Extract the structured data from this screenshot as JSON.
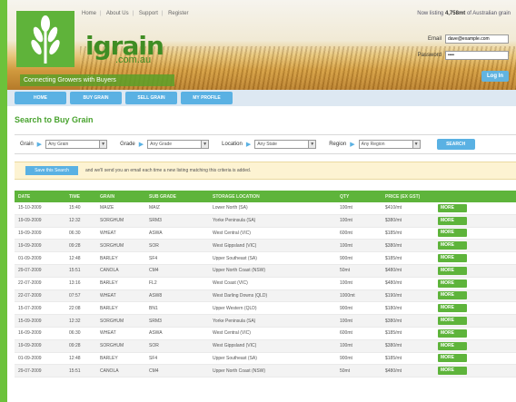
{
  "app": {
    "logo_text": "igrain",
    "logo_domain": ".com.au",
    "tagline": "Connecting Growers with Buyers"
  },
  "header": {
    "links": [
      "Home",
      "About Us",
      "Support",
      "Register"
    ],
    "listing_msg_count": "4,758mt",
    "listing_msg_prefix": "Now listing",
    "listing_msg_suffix": "of Australian grain"
  },
  "login": {
    "email_label": "Email",
    "email_value": "dave@example.com",
    "password_label": "Password",
    "password_value": "••••",
    "button": "Log In"
  },
  "nav": {
    "items": [
      "HOME",
      "BUY GRAIN",
      "SELL GRAIN",
      "MY PROFILE"
    ]
  },
  "search": {
    "title": "Search to Buy Grain",
    "grain_label": "Grain",
    "grain_value": "Any Grain",
    "grade_label": "Grade",
    "grade_value": "Any Grade",
    "location_label": "Location",
    "location_value": "Any State",
    "region_label": "Region",
    "region_value": "Any Region",
    "button": "SEARCH"
  },
  "alert": {
    "button": "Save this Search",
    "text": "and we'll send you an email each time a new listing matching this criteria is added."
  },
  "table": {
    "columns": [
      "DATE",
      "TIME",
      "GRAIN",
      "SUB GRADE",
      "STORAGE LOCATION",
      "QTY",
      "PRICE (EX GST)",
      ""
    ],
    "more_label": "MORE",
    "rows": [
      [
        "15-10-2009",
        "15:40",
        "MAIZE",
        "MAIZ",
        "Lower North (SA)",
        "100mt",
        "$410/mt"
      ],
      [
        "19-09-2009",
        "12:32",
        "SORGHUM",
        "SRM3",
        "Yorke Peninsula (SA)",
        "100mt",
        "$380/mt"
      ],
      [
        "19-09-2009",
        "06:30",
        "WHEAT",
        "ASWA",
        "West Central (VIC)",
        "600mt",
        "$185/mt"
      ],
      [
        "19-09-2009",
        "09:28",
        "SORGHUM",
        "SOR",
        "West Gippsland (VIC)",
        "100mt",
        "$380/mt"
      ],
      [
        "01-09-2009",
        "12:48",
        "BARLEY",
        "SF4",
        "Upper Southeast (SA)",
        "900mt",
        "$185/mt"
      ],
      [
        "29-07-2009",
        "15:51",
        "CANOLA",
        "CM4",
        "Upper North Coast (NSW)",
        "50mt",
        "$480/mt"
      ],
      [
        "22-07-2009",
        "13:16",
        "BARLEY",
        "FL2",
        "West Coast (VIC)",
        "100mt",
        "$480/mt"
      ],
      [
        "22-07-2009",
        "07:57",
        "WHEAT",
        "ASW8",
        "West Darling Downs (QLD)",
        "1000mt",
        "$190/mt"
      ],
      [
        "15-07-2009",
        "22:08",
        "BARLEY",
        "BN1",
        "Upper Western (QLD)",
        "900mt",
        "$180/mt"
      ],
      [
        "15-09-2009",
        "12:32",
        "SORGHUM",
        "SRM3",
        "Yorke Peninsula (SA)",
        "100mt",
        "$380/mt"
      ],
      [
        "16-09-2009",
        "06:30",
        "WHEAT",
        "ASWA",
        "West Central (VIC)",
        "600mt",
        "$185/mt"
      ],
      [
        "19-09-2009",
        "09:28",
        "SORGHUM",
        "SOR",
        "West Gippsland (VIC)",
        "100mt",
        "$380/mt"
      ],
      [
        "01-09-2009",
        "12:48",
        "BARLEY",
        "SF4",
        "Upper Southeast (SA)",
        "900mt",
        "$185/mt"
      ],
      [
        "29-07-2009",
        "15:51",
        "CANOLA",
        "CM4",
        "Upper North Coast (NSW)",
        "50mt",
        "$480/mt"
      ]
    ]
  },
  "colors": {
    "brand_green": "#5eb43b",
    "nav_blue": "#5ab1e3",
    "alert_bg": "#fdf3d2"
  }
}
